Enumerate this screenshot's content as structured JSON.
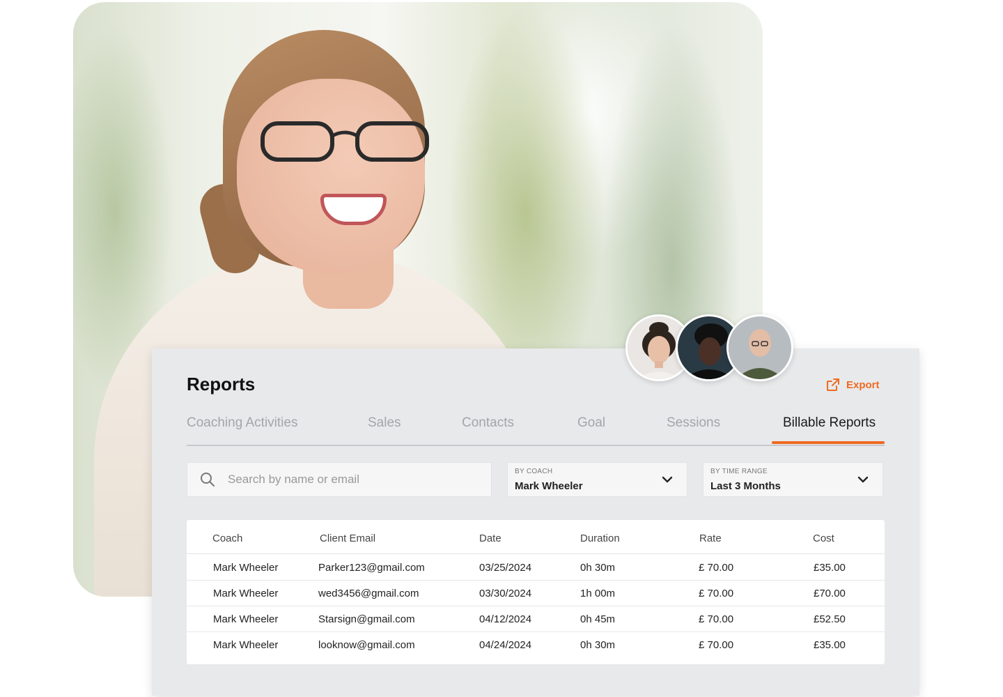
{
  "hero": {
    "alt": "Smiling woman with glasses"
  },
  "avatars": [
    {
      "name": "avatar-woman"
    },
    {
      "name": "avatar-man-hat"
    },
    {
      "name": "avatar-man-bald"
    }
  ],
  "reports": {
    "title": "Reports",
    "export_label": "Export",
    "tabs": [
      {
        "label": "Coaching  Activities",
        "active": false
      },
      {
        "label": "Sales",
        "active": false
      },
      {
        "label": "Contacts",
        "active": false
      },
      {
        "label": "Goal",
        "active": false
      },
      {
        "label": "Sessions",
        "active": false
      },
      {
        "label": "Billable Reports",
        "active": true
      }
    ],
    "search": {
      "placeholder": "Search by name or email",
      "value": ""
    },
    "filters": {
      "coach": {
        "label": "BY COACH",
        "value": "Mark Wheeler"
      },
      "time_range": {
        "label": "BY TIME RANGE",
        "value": "Last 3 Months"
      }
    },
    "table": {
      "columns": [
        "Coach",
        "Client Email",
        "Date",
        "Duration",
        "Rate",
        "Cost"
      ],
      "rows": [
        [
          "Mark Wheeler",
          "Parker123@gmail.com",
          "03/25/2024",
          "0h 30m",
          "£ 70.00",
          "£35.00"
        ],
        [
          "Mark Wheeler",
          "wed3456@gmail.com",
          "03/30/2024",
          "1h 00m",
          "£ 70.00",
          "£70.00"
        ],
        [
          "Mark Wheeler",
          "Starsign@gmail.com",
          "04/12/2024",
          "0h 45m",
          "£ 70.00",
          "£52.50"
        ],
        [
          "Mark Wheeler",
          "looknow@gmail.com",
          "04/24/2024",
          "0h 30m",
          "£ 70.00",
          "£35.00"
        ]
      ]
    }
  },
  "colors": {
    "accent": "#ef6a21",
    "card_bg": "#e8e9eb",
    "tab_inactive": "#a4a5a9"
  },
  "icons": {
    "search": "search-icon",
    "export": "external-link-icon",
    "chevron": "chevron-down-icon"
  }
}
